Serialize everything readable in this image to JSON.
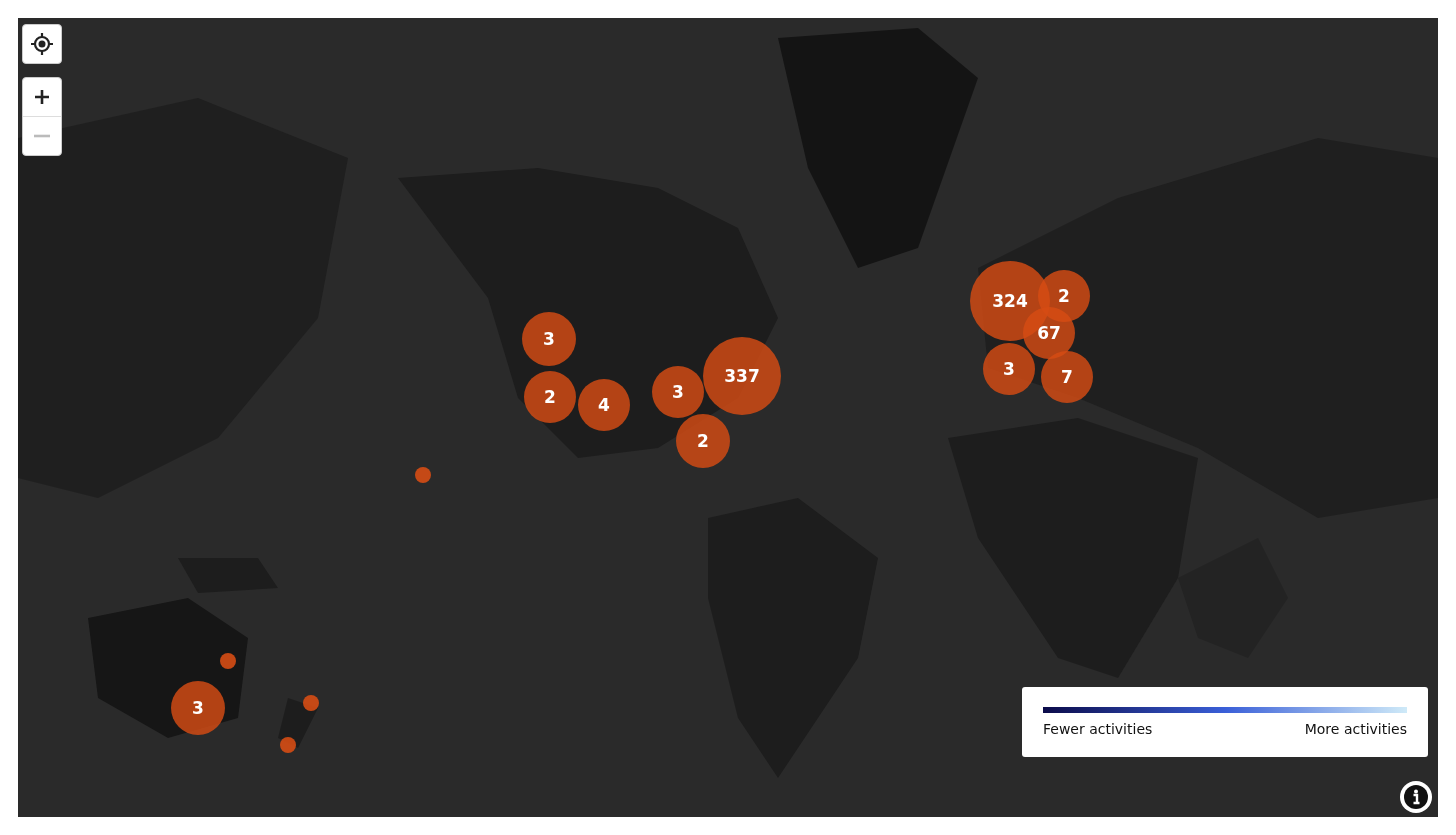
{
  "map": {
    "markers": [
      {
        "kind": "cluster",
        "count": "3"
      },
      {
        "kind": "cluster",
        "count": "2"
      },
      {
        "kind": "cluster",
        "count": "4"
      },
      {
        "kind": "cluster",
        "count": "3"
      },
      {
        "kind": "cluster",
        "count": "337"
      },
      {
        "kind": "cluster",
        "count": "2"
      },
      {
        "kind": "cluster",
        "count": "324"
      },
      {
        "kind": "cluster",
        "count": "2"
      },
      {
        "kind": "cluster",
        "count": "67"
      },
      {
        "kind": "cluster",
        "count": "3"
      },
      {
        "kind": "cluster",
        "count": "7"
      },
      {
        "kind": "cluster",
        "count": "3"
      },
      {
        "kind": "dot"
      },
      {
        "kind": "dot"
      },
      {
        "kind": "dot"
      },
      {
        "kind": "dot"
      }
    ]
  },
  "legend": {
    "low_label": "Fewer activities",
    "high_label": "More activities"
  }
}
